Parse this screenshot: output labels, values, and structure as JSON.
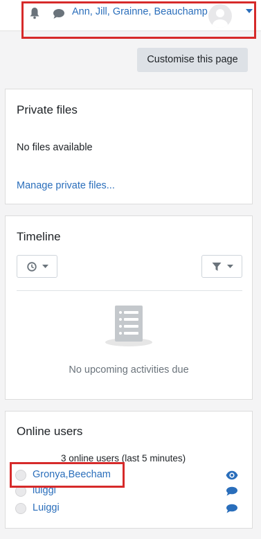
{
  "header": {
    "user_name": "Ann, Jill, Grainne, Beauchamp",
    "icons": {
      "notifications": "bell-icon",
      "messages": "chat-bubble-icon",
      "user_menu": "chevron-down-icon"
    }
  },
  "customise_button": "Customise this page",
  "private_files": {
    "title": "Private files",
    "empty_text": "No files available",
    "manage_link": "Manage private files..."
  },
  "timeline": {
    "title": "Timeline",
    "sort_icon": "clock-icon",
    "filter_icon": "filter-icon",
    "empty_text": "No upcoming activities due"
  },
  "online_users": {
    "title": "Online users",
    "count_text": "3 online users (last 5 minutes)",
    "users": [
      {
        "name": "Gronya,Beecham",
        "action_icon": "eye-icon"
      },
      {
        "name": "luiggi",
        "action_icon": "chat-bubble-icon"
      },
      {
        "name": "Luiggi",
        "action_icon": "chat-bubble-icon"
      }
    ]
  },
  "colors": {
    "link": "#2a6ebb",
    "highlight": "#d62a2a",
    "page_background": "#f4f4f5"
  }
}
